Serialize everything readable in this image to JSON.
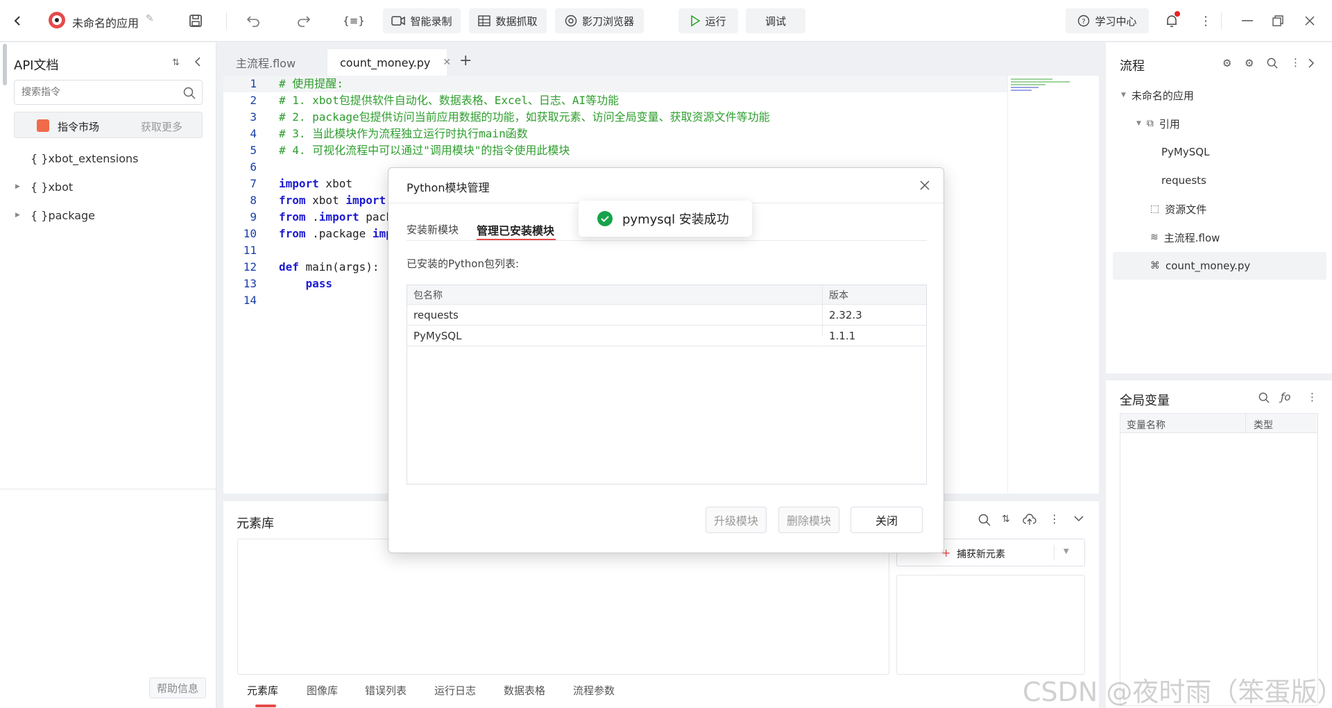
{
  "app": {
    "title": "未命名的应用"
  },
  "toolbar": {
    "smart_record": "智能录制",
    "data_capture": "数据抓取",
    "browser": "影刀浏览器",
    "run": "运行",
    "debug": "调试",
    "learning_center": "学习中心"
  },
  "left_panel": {
    "title": "API文档",
    "search_placeholder": "搜索指令",
    "market_label": "指令市场",
    "get_more": "获取更多",
    "tree": [
      "{ }xbot_extensions",
      "{ }xbot",
      "{ }package"
    ],
    "help": "帮助信息"
  },
  "editor": {
    "tabs": [
      "主流程.flow",
      "count_money.py"
    ],
    "lines": [
      {
        "n": "1",
        "html": "<span class='cm'># 使用提醒:</span>"
      },
      {
        "n": "2",
        "html": "<span class='cm'># 1. xbot包提供软件自动化、数据表格、Excel、日志、AI等功能</span>"
      },
      {
        "n": "3",
        "html": "<span class='cm'># 2. package包提供访问当前应用数据的功能，如获取元素、访问全局变量、获取资源文件等功能</span>"
      },
      {
        "n": "4",
        "html": "<span class='cm'># 3. 当此模块作为流程独立运行时执行main函数</span>"
      },
      {
        "n": "5",
        "html": "<span class='cm'># 4. 可视化流程中可以通过\"调用模块\"的指令使用此模块</span>"
      },
      {
        "n": "6",
        "html": ""
      },
      {
        "n": "7",
        "html": "<span class='kw'>import</span> xbot"
      },
      {
        "n": "8",
        "html": "<span class='kw'>from</span> xbot <span class='kw'>import</span>"
      },
      {
        "n": "9",
        "html": "<span class='kw'>from</span> .<span class='kw'>import</span> pack"
      },
      {
        "n": "10",
        "html": "<span class='kw'>from</span> .package <span class='kw'>imp</span>"
      },
      {
        "n": "11",
        "html": ""
      },
      {
        "n": "12",
        "html": "<span class='kw'>def</span> main(args):"
      },
      {
        "n": "13",
        "html": "    <span class='kw'>pass</span>"
      },
      {
        "n": "14",
        "html": ""
      }
    ]
  },
  "element_lib": {
    "title": "元素库",
    "capture": "捕获新元素",
    "tabs": [
      "元素库",
      "图像库",
      "错误列表",
      "运行日志",
      "数据表格",
      "流程参数"
    ]
  },
  "right_panel": {
    "title": "流程",
    "tree": {
      "app": "未命名的应用",
      "ref": "引用",
      "pymysql": "PyMySQL",
      "requests": "requests",
      "resources": "资源文件",
      "main_flow": "主流程.flow",
      "count_money": "count_money.py"
    },
    "globals_title": "全局变量",
    "col_name": "变量名称",
    "col_type": "类型"
  },
  "dialog": {
    "title": "Python模块管理",
    "tabs": [
      "安装新模块",
      "管理已安装模块"
    ],
    "list_label": "已安装的Python包列表:",
    "col_name": "包名称",
    "col_version": "版本",
    "rows": [
      {
        "name": "requests",
        "version": "2.32.3"
      },
      {
        "name": "PyMySQL",
        "version": "1.1.1"
      }
    ],
    "upgrade": "升级模块",
    "remove": "删除模块",
    "close": "关闭"
  },
  "toast": {
    "message": "pymysql 安装成功"
  },
  "watermark": "CSDN @夜时雨（笨蛋版）",
  "colors": {
    "accent": "#e64a4a",
    "success": "#16a34a",
    "code_keyword": "#1d1bd1",
    "code_comment": "#2e9e2e"
  }
}
